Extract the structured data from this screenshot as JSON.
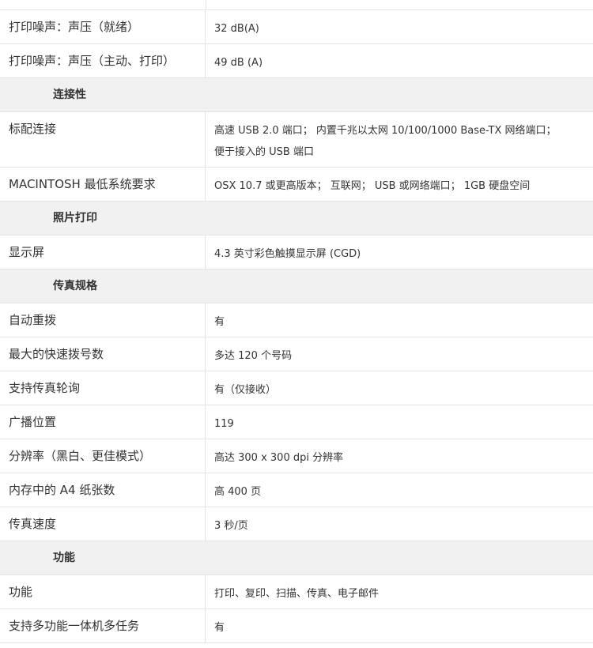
{
  "rows": [
    {
      "type": "spec",
      "label": "打印噪声：声压（就绪）",
      "value": "32 dB(A)"
    },
    {
      "type": "spec",
      "label": "打印噪声：声压（主动、打印）",
      "value": "49 dB (A)"
    },
    {
      "type": "section",
      "title": "连接性"
    },
    {
      "type": "spec",
      "label": "标配连接",
      "value_lines": [
        "高速 USB 2.0 端口； 内置千兆以太网 10/100/1000 Base-TX 网络端口；",
        "便于接入的 USB 端口"
      ]
    },
    {
      "type": "spec",
      "label": "MACINTOSH 最低系统要求",
      "value": "OSX 10.7 或更高版本； 互联网； USB 或网络端口； 1GB 硬盘空间"
    },
    {
      "type": "section",
      "title": "照片打印"
    },
    {
      "type": "spec",
      "label": "显示屏",
      "value": "4.3 英寸彩色触摸显示屏 (CGD)"
    },
    {
      "type": "section",
      "title": "传真规格"
    },
    {
      "type": "spec",
      "label": "自动重拨",
      "value": "有"
    },
    {
      "type": "spec",
      "label": "最大的快速拨号数",
      "value": "多达 120 个号码"
    },
    {
      "type": "spec",
      "label": "支持传真轮询",
      "value": "有（仅接收）"
    },
    {
      "type": "spec",
      "label": "广播位置",
      "value": "119"
    },
    {
      "type": "spec",
      "label": "分辨率（黑白、更佳模式）",
      "value": "高达 300 x 300 dpi 分辨率"
    },
    {
      "type": "spec",
      "label": "内存中的 A4 纸张数",
      "value": "高 400 页"
    },
    {
      "type": "spec",
      "label": "传真速度",
      "value": "3 秒/页"
    },
    {
      "type": "section",
      "title": "功能"
    },
    {
      "type": "spec",
      "label": "功能",
      "value": "打印、复印、扫描、传真、电子邮件"
    },
    {
      "type": "spec",
      "label": "支持多功能一体机多任务",
      "value": "有"
    }
  ]
}
